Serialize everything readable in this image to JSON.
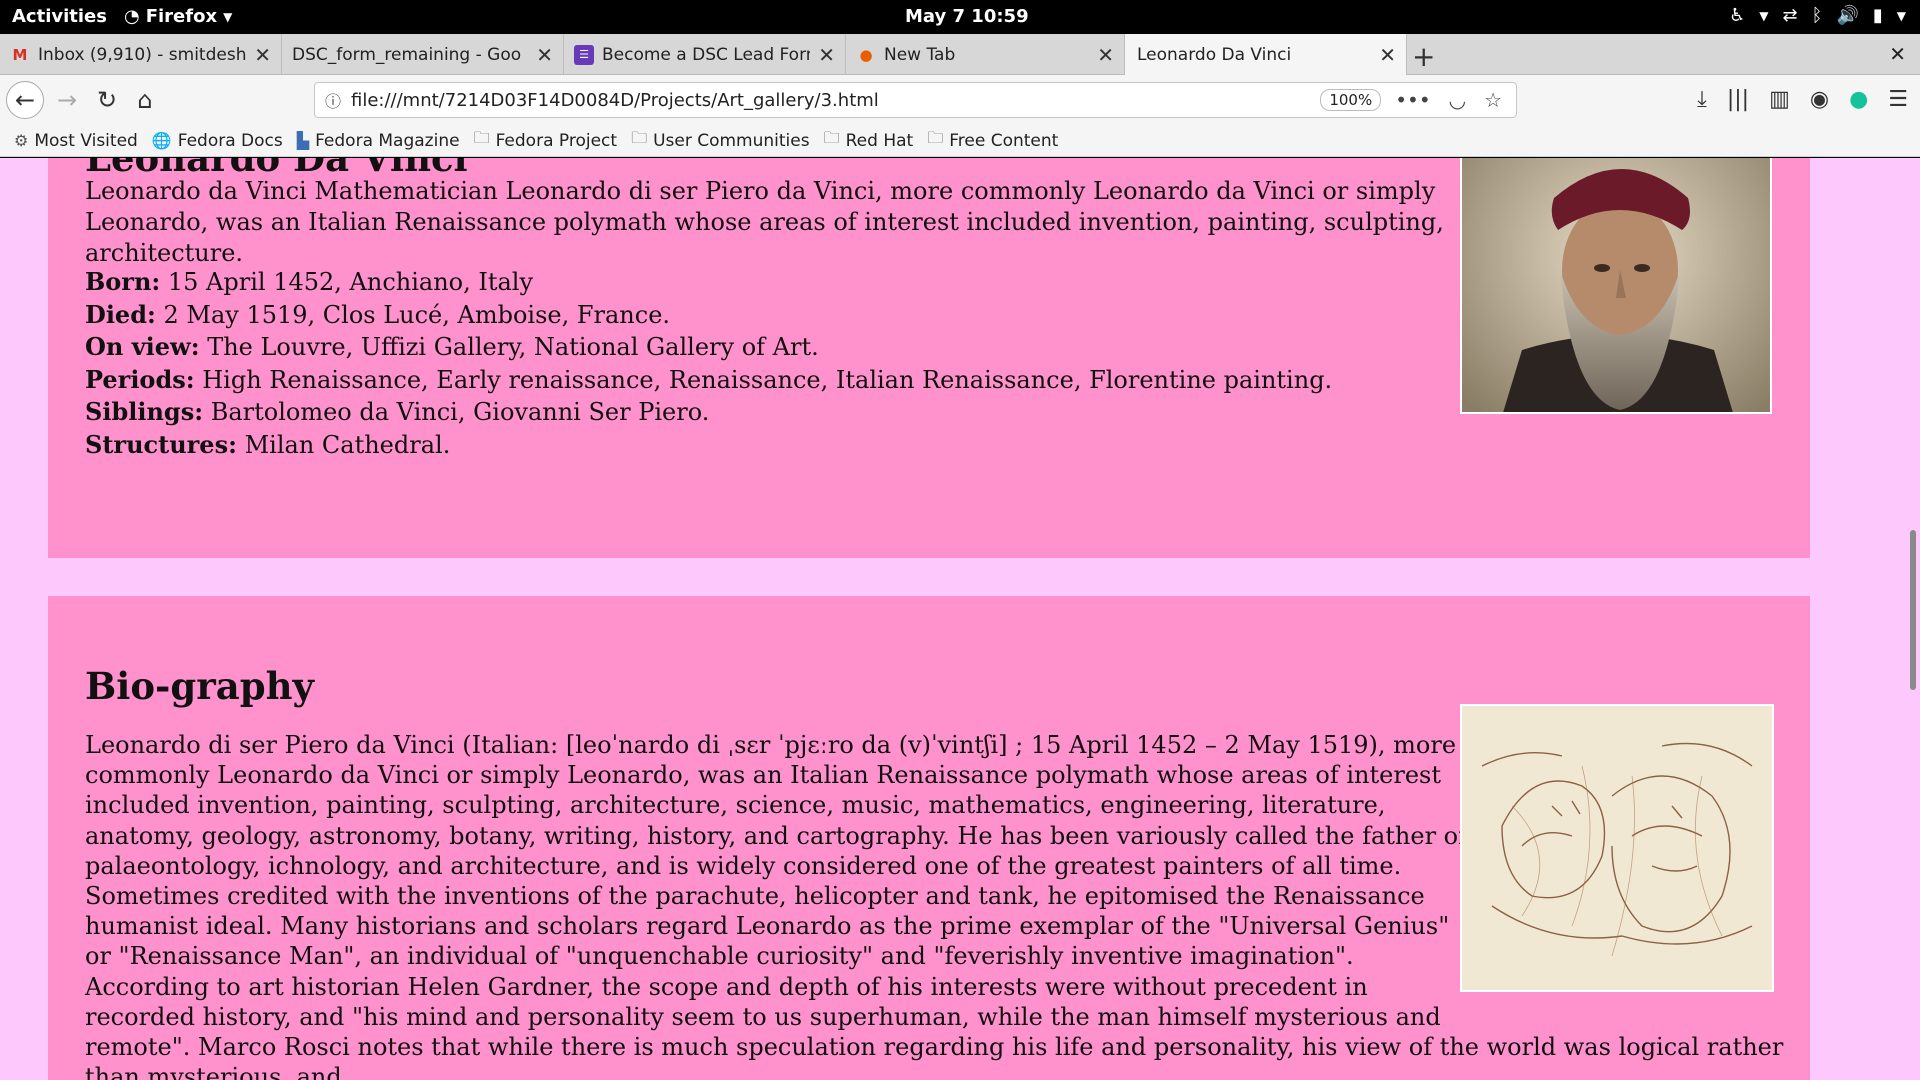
{
  "topbar": {
    "activities": "Activities",
    "app": "Firefox",
    "clock": "May 7  10:59"
  },
  "tabs": [
    {
      "title": "Inbox (9,910) - smitdeshm",
      "icon": "gmail-icon"
    },
    {
      "title": "DSC_form_remaining - Goo",
      "icon": "none"
    },
    {
      "title": "Become a DSC Lead Form",
      "icon": "forms-icon"
    },
    {
      "title": "New Tab",
      "icon": "firefox-icon"
    },
    {
      "title": "Leonardo Da Vinci",
      "icon": "none"
    }
  ],
  "navbar": {
    "url": "file:///mnt/7214D03F14D0084D/Projects/Art_gallery/3.html",
    "zoom": "100%"
  },
  "bookmarks": [
    "Most Visited",
    "Fedora Docs",
    "Fedora Magazine",
    "Fedora Project",
    "User Communities",
    "Red Hat",
    "Free Content"
  ],
  "card1": {
    "title": "Leonardo Da Vinci",
    "intro": "Leonardo da Vinci Mathematician Leonardo di ser Piero da Vinci, more commonly Leonardo da Vinci or simply Leonardo, was an Italian Renaissance polymath whose areas of interest included invention, painting, sculpting, architecture.",
    "facts": [
      {
        "label": "Born:",
        "value": " 15 April 1452, Anchiano, Italy"
      },
      {
        "label": "Died:",
        "value": " 2 May 1519, Clos Lucé, Amboise, France."
      },
      {
        "label": "On view:",
        "value": " The Louvre, Uffizi Gallery, National Gallery of Art."
      },
      {
        "label": "Periods:",
        "value": " High Renaissance, Early renaissance, Renaissance, Italian Renaissance, Florentine painting."
      },
      {
        "label": "Siblings:",
        "value": " Bartolomeo da Vinci, Giovanni Ser Piero."
      },
      {
        "label": "Structures:",
        "value": " Milan Cathedral."
      }
    ]
  },
  "card2": {
    "title": "Bio-graphy",
    "body": "Leonardo di ser Piero da Vinci (Italian: [leoˈnardo di ˌsɛr ˈpjɛːro da (v)ˈvintʃi] ; 15 April 1452 – 2 May 1519), more commonly Leonardo da Vinci or simply Leonardo, was an Italian Renaissance polymath whose areas of interest included invention, painting, sculpting, architecture, science, music, mathematics, engineering, literature, anatomy, geology, astronomy, botany, writing, history, and cartography. He has been variously called the father of palaeontology, ichnology, and architecture, and is widely considered one of the greatest painters of all time. Sometimes credited with the inventions of the parachute, helicopter and tank, he epitomised the Renaissance humanist ideal. Many historians and scholars regard Leonardo as the prime exemplar of the \"Universal Genius\" or \"Renaissance Man\", an individual of \"unquenchable curiosity\" and \"feverishly inventive imagination\". According to art historian Helen Gardner, the scope and depth of his interests were without precedent in recorded history, and \"his mind and personality seem to us superhuman, while the man himself mysterious and remote\". Marco Rosci notes that while there is much speculation regarding his life and personality, his view of the world was logical rather than mysterious, and"
  }
}
